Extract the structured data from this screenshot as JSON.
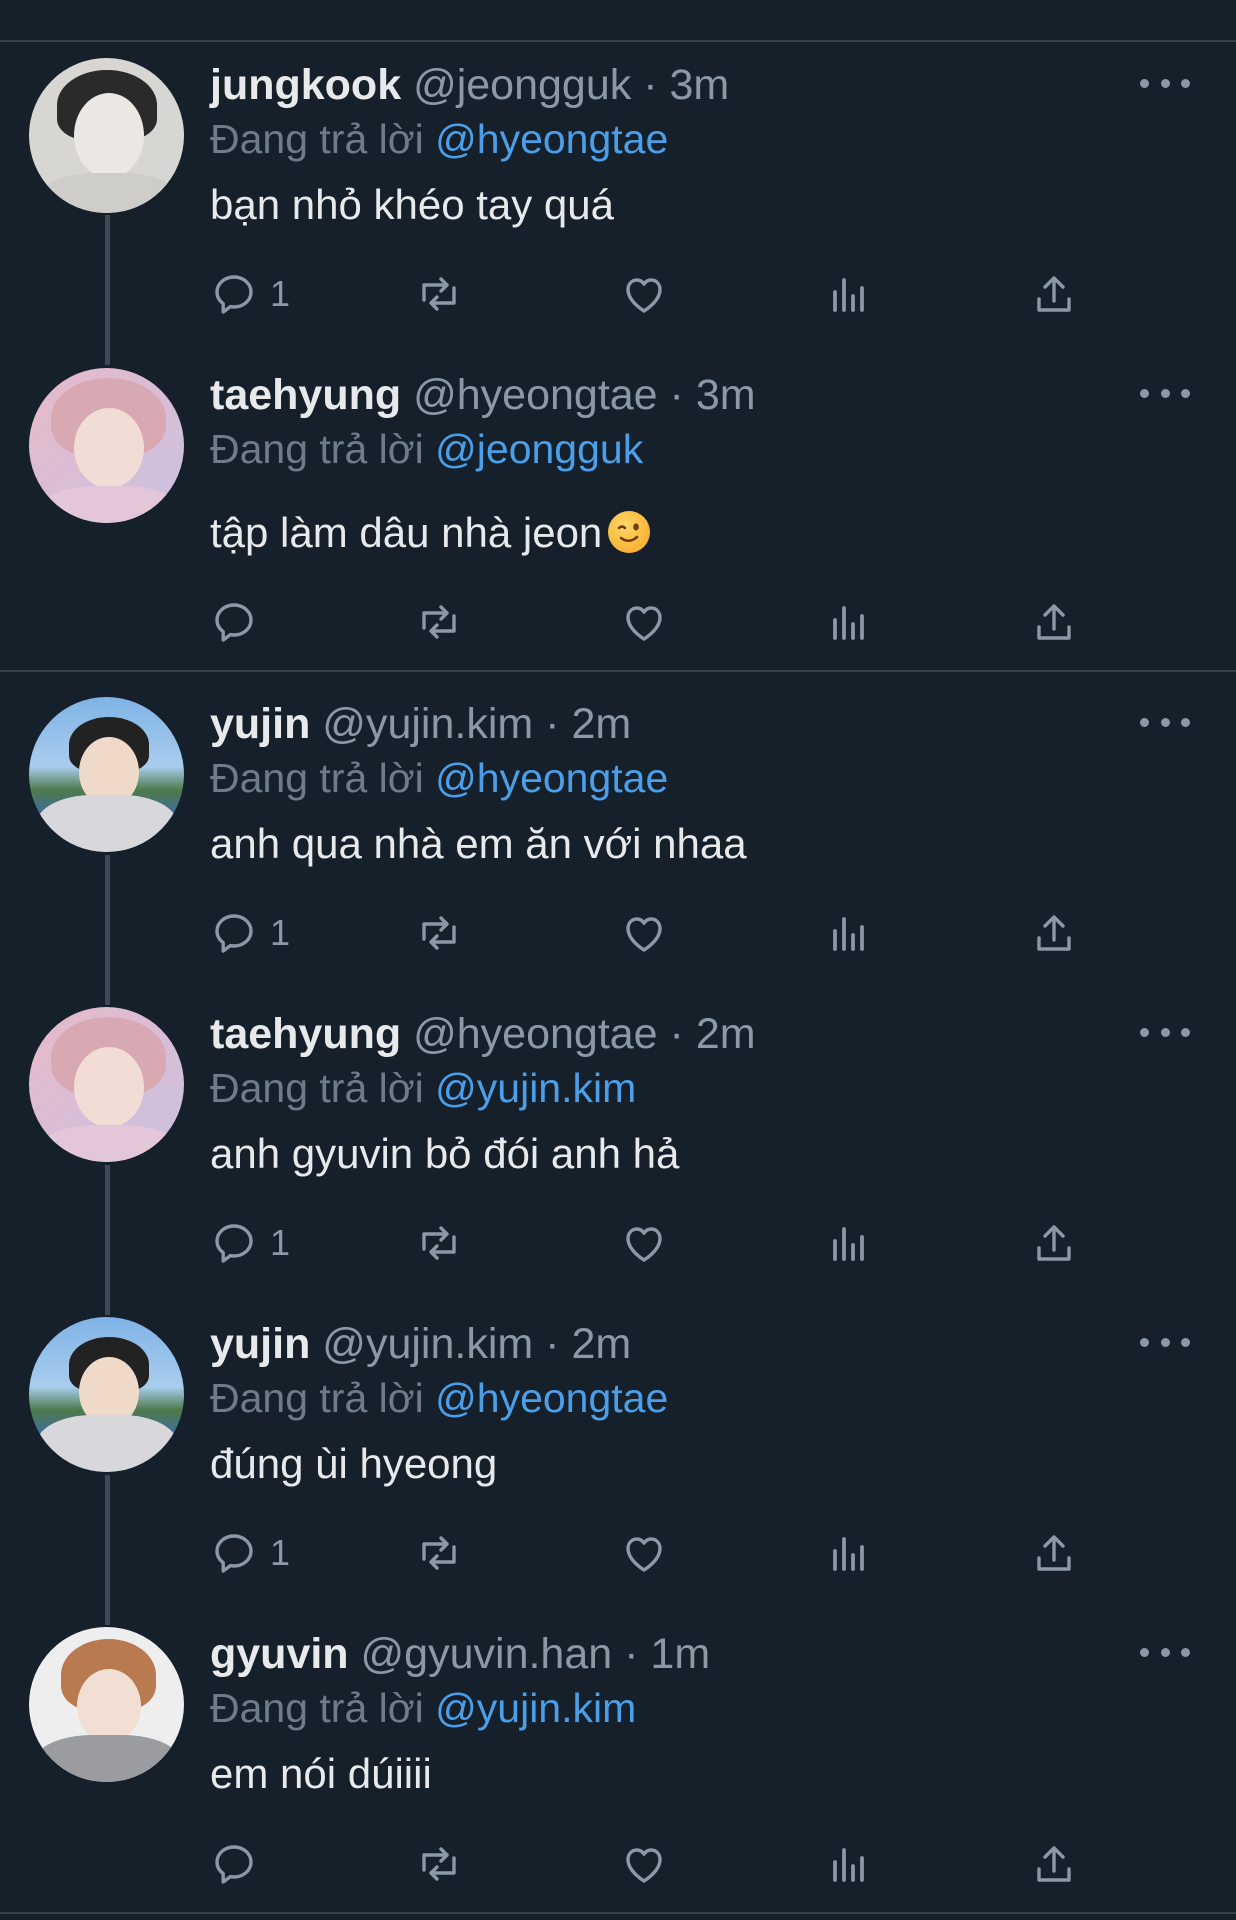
{
  "colors": {
    "background": "#15202b",
    "divider": "#38444d",
    "accent": "#4a9fe8",
    "muted": "#8b98a5"
  },
  "tweets": [
    {
      "name": "jungkook",
      "handle": "@jeongguk",
      "dot": "·",
      "time": "3m",
      "reply_prefix": "Đang trả lời",
      "reply_to": "@hyeongtae",
      "text": "bạn nhỏ khéo tay quá",
      "reply_count": "1",
      "avatar_icon": "avatar-photo"
    },
    {
      "name": "taehyung",
      "handle": "@hyeongtae",
      "dot": "·",
      "time": "3m",
      "reply_prefix": "Đang trả lời",
      "reply_to": "@jeongguk",
      "text": "tập làm dâu nhà jeon",
      "emoji": "winking-face-emoji",
      "reply_count": "",
      "avatar_icon": "avatar-photo"
    },
    {
      "name": "yujin",
      "handle": "@yujin.kim",
      "dot": "·",
      "time": "2m",
      "reply_prefix": "Đang trả lời",
      "reply_to": "@hyeongtae",
      "text": "anh qua nhà em ăn với nhaa",
      "reply_count": "1",
      "avatar_icon": "avatar-photo"
    },
    {
      "name": "taehyung",
      "handle": "@hyeongtae",
      "dot": "·",
      "time": "2m",
      "reply_prefix": "Đang trả lời",
      "reply_to": "@yujin.kim",
      "text": "anh gyuvin bỏ đói anh hả",
      "reply_count": "1",
      "avatar_icon": "avatar-photo"
    },
    {
      "name": "yujin",
      "handle": "@yujin.kim",
      "dot": "·",
      "time": "2m",
      "reply_prefix": "Đang trả lời",
      "reply_to": "@hyeongtae",
      "text": "đúng ùi hyeong",
      "reply_count": "1",
      "avatar_icon": "avatar-photo"
    },
    {
      "name": "gyuvin",
      "handle": "@gyuvin.han",
      "dot": "·",
      "time": "1m",
      "reply_prefix": "Đang trả lời",
      "reply_to": "@yujin.kim",
      "text": "em nói dúiiii",
      "reply_count": "",
      "avatar_icon": "avatar-photo"
    }
  ]
}
